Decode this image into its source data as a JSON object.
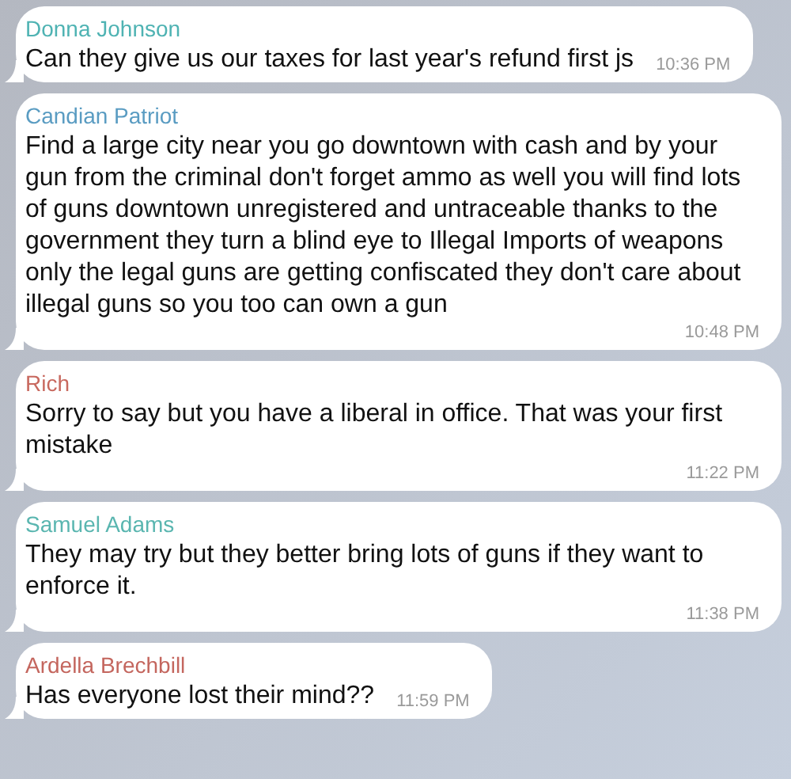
{
  "messages": [
    {
      "sender": "Donna Johnson",
      "color": "#4fb3b3",
      "text": "Can they give us our taxes for last year's refund first js",
      "time": "10:36 PM"
    },
    {
      "sender": "Candian Patriot",
      "color": "#5a9cc2",
      "text": "Find a large city near you go downtown with cash and by your gun from the criminal don't forget ammo as well you will find lots of guns downtown unregistered and untraceable thanks to the government they turn a blind eye to Illegal Imports of weapons only the legal guns are getting confiscated they don't care about illegal guns so you too can own a gun",
      "time": "10:48 PM"
    },
    {
      "sender": "Rich",
      "color": "#c8695f",
      "text": "Sorry to say but you have a liberal in office. That was your first mistake",
      "time": "11:22 PM"
    },
    {
      "sender": "Samuel Adams",
      "color": "#5ab6b0",
      "text": "They may try but they better bring lots of guns if they want to enforce it.",
      "time": "11:38 PM"
    },
    {
      "sender": "Ardella Brechbill",
      "color": "#c4665e",
      "text": "Has everyone lost their mind??",
      "time": "11:59 PM"
    }
  ]
}
